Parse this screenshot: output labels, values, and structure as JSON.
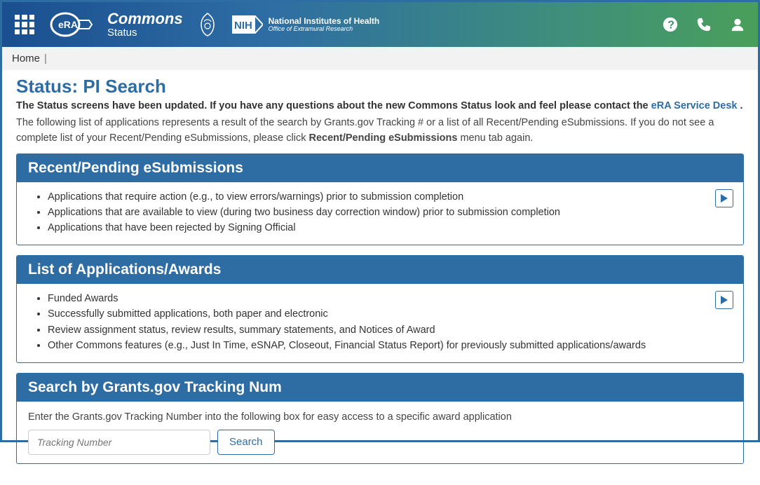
{
  "header": {
    "brand_commons": "Commons",
    "brand_status": "Status",
    "nih_line1": "National Institutes of Health",
    "nih_line2": "Office of Extramural Research"
  },
  "breadcrumb": {
    "home": "Home"
  },
  "page": {
    "title": "Status: PI Search",
    "notice_prefix": "The Status screens have been updated. If you have any questions about the new Commons Status look and feel please contact the ",
    "notice_link": "eRA Service Desk",
    "notice_suffix": " .",
    "intro_part1": "The following list of applications represents a result of the search by Grants.gov Tracking # or a list of all Recent/Pending eSubmissions. If you do not see a complete list of your Recent/Pending eSubmissions, please click ",
    "intro_bold": "Recent/Pending eSubmissions",
    "intro_part2": " menu tab again."
  },
  "panels": {
    "recent": {
      "title": "Recent/Pending eSubmissions",
      "items": [
        "Applications that require action (e.g., to view errors/warnings) prior to submission completion",
        "Applications that are available to view (during two business day correction window) prior to submission completion",
        "Applications that have been rejected by Signing Official"
      ]
    },
    "awards": {
      "title": "List of Applications/Awards",
      "items": [
        "Funded Awards",
        "Successfully submitted applications, both paper and electronic",
        "Review assignment status, review results, summary statements, and Notices of Award",
        "Other Commons features (e.g., Just In Time, eSNAP, Closeout, Financial Status Report) for previously submitted applications/awards"
      ]
    },
    "search": {
      "title": "Search by Grants.gov Tracking Num",
      "instruction": "Enter the Grants.gov Tracking Number into the following box for easy access to a specific award application",
      "placeholder": "Tracking Number",
      "button": "Search"
    }
  }
}
